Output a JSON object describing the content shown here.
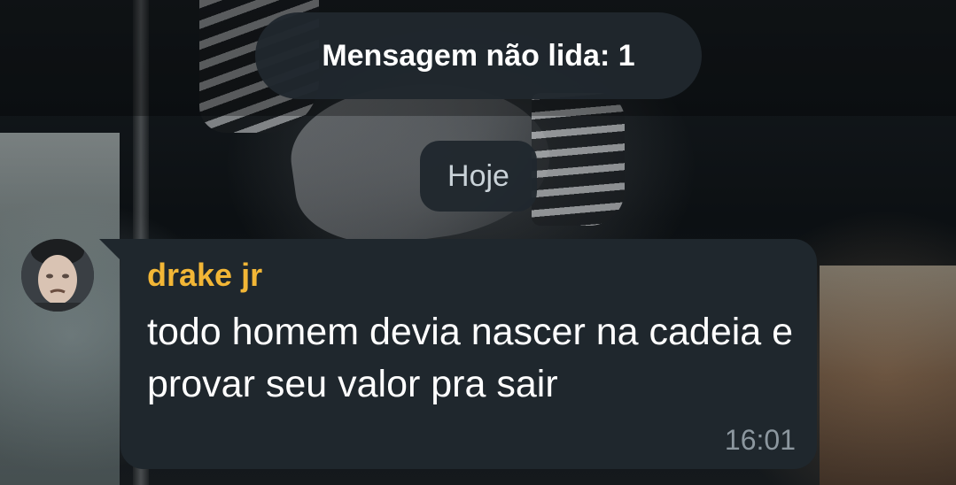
{
  "unread_banner": {
    "label": "Mensagem não lida: 1"
  },
  "date_separator": {
    "label": "Hoje"
  },
  "message": {
    "sender": "drake jr",
    "text": "todo homem devia nascer na cadeia e provar seu valor pra sair",
    "time": "16:01"
  },
  "colors": {
    "bubble": "#1f272d",
    "pill": "#20282e",
    "sender_name": "#f2b636",
    "timestamp": "#8c979f",
    "text": "#ffffff"
  }
}
